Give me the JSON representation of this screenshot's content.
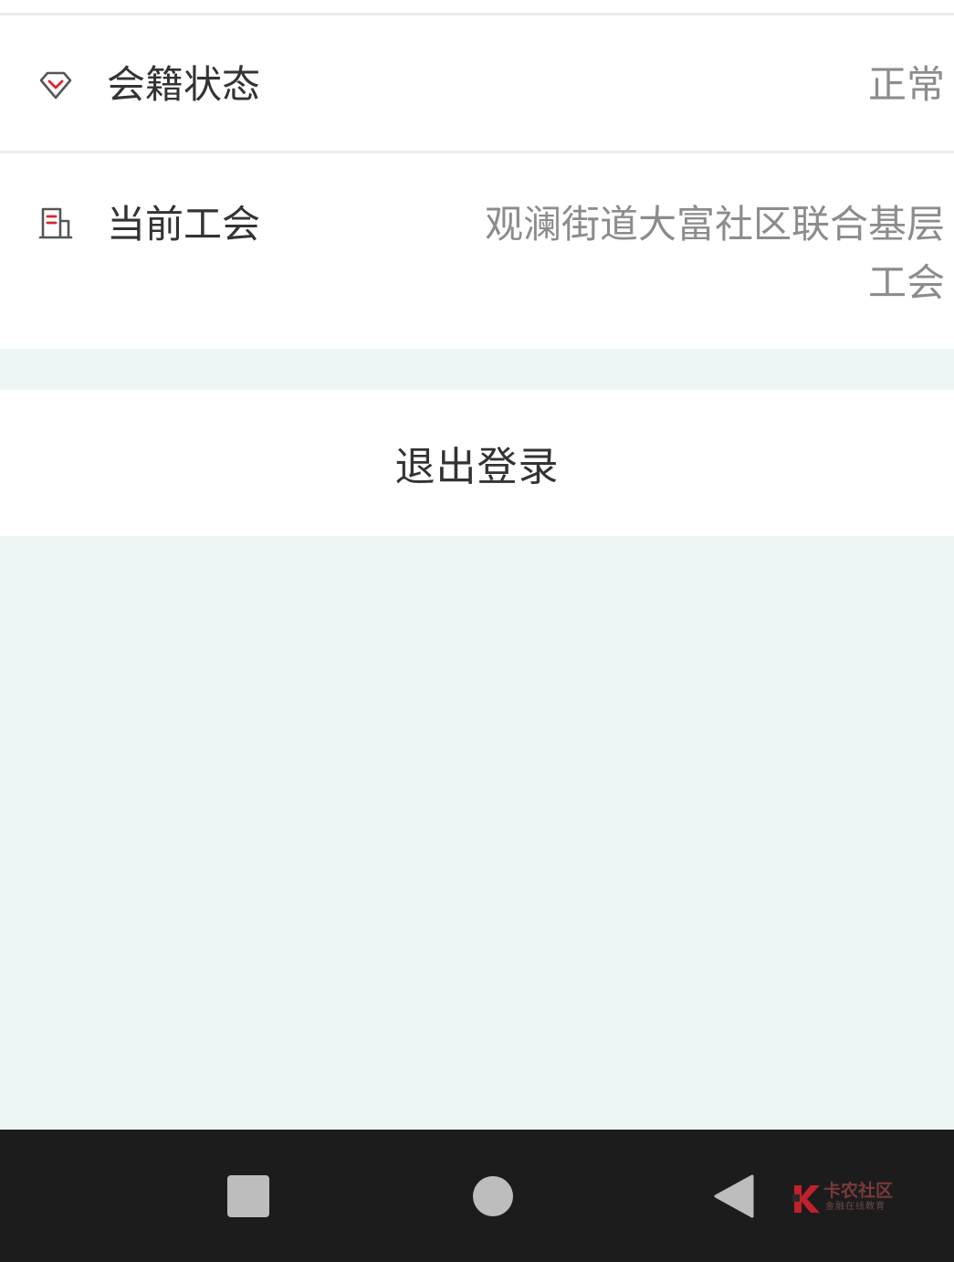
{
  "rows": [
    {
      "label": "会籍状态",
      "value": "正常",
      "icon": "diamond-icon"
    },
    {
      "label": "当前工会",
      "value_line1": "观澜街道大富社区联合基层",
      "value_line2": "工会",
      "icon": "building-icon"
    }
  ],
  "logout": {
    "label": "退出登录"
  },
  "navbar": {
    "buttons": [
      "recent-apps",
      "home",
      "back"
    ],
    "watermark": {
      "title": "卡农社区",
      "subtitle": "金融在线教育"
    }
  },
  "colors": {
    "accent": "#d8262f",
    "background": "#eef5f5",
    "label": "#333333",
    "value": "#8c8c8c",
    "navbar": "#1c1c1c"
  }
}
